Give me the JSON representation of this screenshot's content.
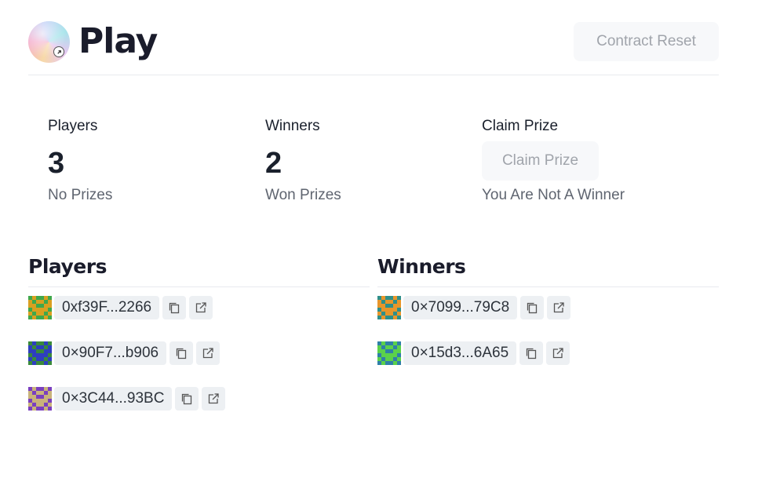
{
  "header": {
    "title": "Play",
    "reset_label": "Contract Reset"
  },
  "stats": {
    "players": {
      "label": "Players",
      "value": "3",
      "help": "No Prizes"
    },
    "winners": {
      "label": "Winners",
      "value": "2",
      "help": "Won Prizes"
    },
    "claim": {
      "label": "Claim Prize",
      "button_label": "Claim Prize",
      "help": "You Are Not A Winner"
    }
  },
  "players_section": {
    "title": "Players",
    "items": [
      {
        "address": "0xf39F...2266",
        "avatar_colors": [
          "#d9a020",
          "#3fa84c"
        ]
      },
      {
        "address": "0×90F7...b906",
        "avatar_colors": [
          "#2e3fbf",
          "#3a8a3a"
        ]
      },
      {
        "address": "0×3C44...93BC",
        "avatar_colors": [
          "#c9b27a",
          "#7a3fbf"
        ]
      }
    ]
  },
  "winners_section": {
    "title": "Winners",
    "items": [
      {
        "address": "0×7099...79C8",
        "avatar_colors": [
          "#e8962a",
          "#2f8f8a"
        ]
      },
      {
        "address": "0×15d3...6A65",
        "avatar_colors": [
          "#5bd14a",
          "#2f7fa8"
        ]
      }
    ]
  },
  "icons": {
    "copy": "copy-icon",
    "external": "external-link-icon"
  }
}
